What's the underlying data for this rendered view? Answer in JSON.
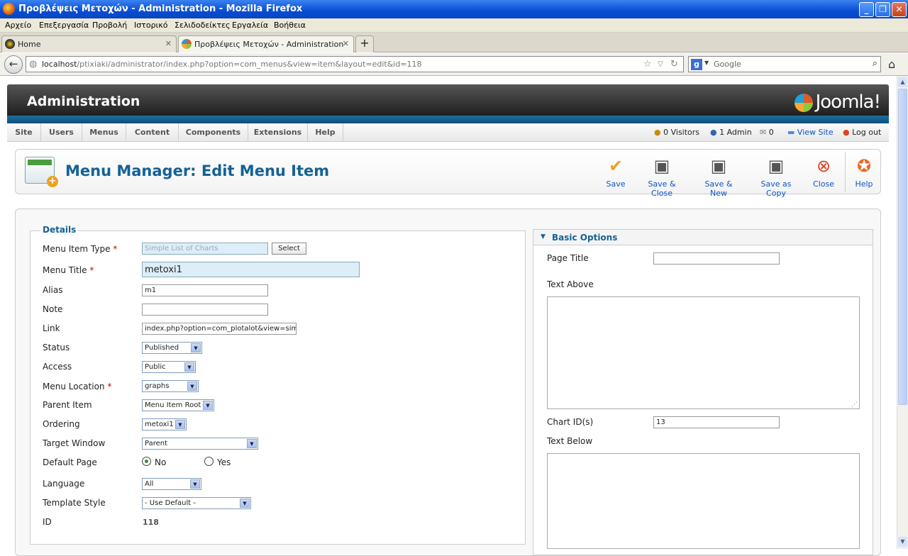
{
  "browser": {
    "window_title": "Προβλέψεις Μετοχών - Administration - Mozilla Firefox",
    "menu": [
      "Αρχείο",
      "Επεξεργασία",
      "Προβολή",
      "Ιστορικό",
      "Σελιδοδείκτες",
      "Εργαλεία",
      "Βοήθεια"
    ],
    "tabs": [
      {
        "label": "Home",
        "active": false
      },
      {
        "label": "Προβλέψεις Μετοχών - Administration",
        "active": true
      }
    ],
    "url_host": "localhost",
    "url_path": "/ptixiaki/administrator/index.php?option=com_menus&view=item&layout=edit&id=118",
    "search_placeholder": "Google"
  },
  "joomla": {
    "header_title": "Administration",
    "logo": "Joomla!",
    "menu": [
      "Site",
      "Users",
      "Menus",
      "Content",
      "Components",
      "Extensions",
      "Help"
    ],
    "status": {
      "visitors": "0 Visitors",
      "admin": "1 Admin",
      "messages": "0",
      "view_site": "View Site",
      "logout": "Log out"
    },
    "page_title": "Menu Manager: Edit Menu Item",
    "toolbar": [
      "Save",
      "Save & Close",
      "Save & New",
      "Save as Copy",
      "Close",
      "Help"
    ]
  },
  "details": {
    "legend": "Details",
    "labels": {
      "menu_item_type": "Menu Item Type",
      "menu_title": "Menu Title",
      "alias": "Alias",
      "note": "Note",
      "link": "Link",
      "status": "Status",
      "access": "Access",
      "menu_location": "Menu Location",
      "parent_item": "Parent Item",
      "ordering": "Ordering",
      "target_window": "Target Window",
      "default_page": "Default Page",
      "language": "Language",
      "template_style": "Template Style",
      "id": "ID"
    },
    "values": {
      "menu_item_type": "Simple List of Charts",
      "select_button": "Select",
      "menu_title": "metoxi1",
      "alias": "m1",
      "note": "",
      "link": "index.php?option=com_plotalot&view=simple",
      "status": "Published",
      "access": "Public",
      "menu_location": "graphs",
      "parent_item": "Menu Item Root",
      "ordering": "metoxi1",
      "target_window": "Parent",
      "default_no": "No",
      "default_yes": "Yes",
      "language": "All",
      "template_style": "- Use Default -",
      "id": "118"
    }
  },
  "basic_options": {
    "title": "Basic Options",
    "page_title_label": "Page Title",
    "page_title_value": "",
    "text_above_label": "Text Above",
    "chart_ids_label": "Chart ID(s)",
    "chart_ids_value": "13",
    "text_below_label": "Text Below"
  }
}
